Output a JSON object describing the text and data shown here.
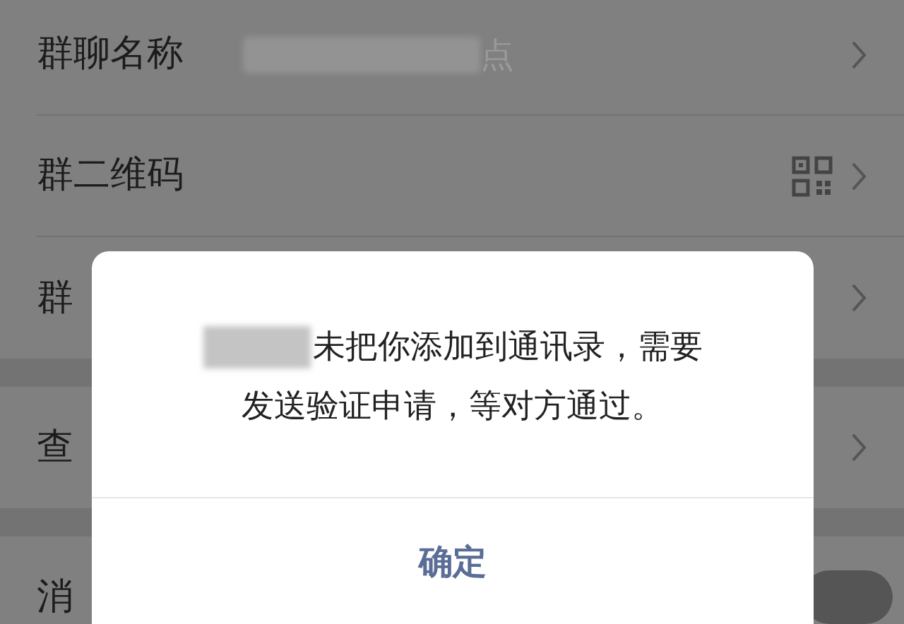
{
  "sections": [
    {
      "rows": [
        {
          "kind": "value",
          "label": "群聊名称",
          "value": "点"
        },
        {
          "kind": "qrcode",
          "label": "群二维码"
        },
        {
          "kind": "plain",
          "label": "群"
        }
      ]
    },
    {
      "rows": [
        {
          "kind": "plain",
          "label": "查"
        }
      ]
    },
    {
      "rows": [
        {
          "kind": "switch",
          "label": "消",
          "on": true
        }
      ]
    }
  ],
  "dialog": {
    "message_lines": [
      "未把你添加到通讯录，需要",
      "发送验证申请，等对方通过。"
    ],
    "button": "确定"
  }
}
